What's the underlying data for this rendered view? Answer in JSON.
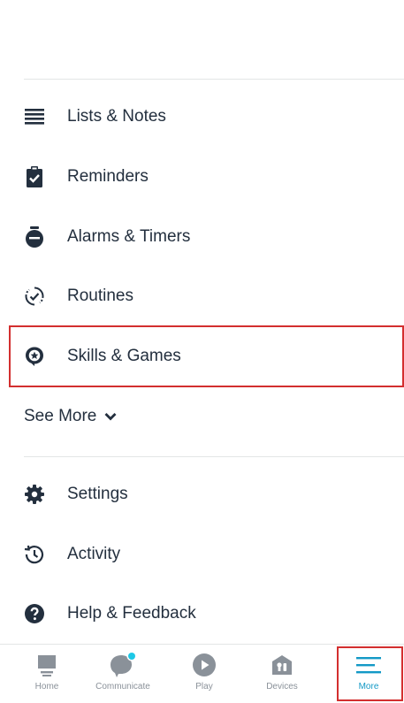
{
  "menu": {
    "items": [
      {
        "label": "Lists & Notes",
        "icon": "list-icon"
      },
      {
        "label": "Reminders",
        "icon": "clipboard-check-icon"
      },
      {
        "label": "Alarms & Timers",
        "icon": "stopwatch-icon"
      },
      {
        "label": "Routines",
        "icon": "routines-cycle-icon"
      },
      {
        "label": "Skills & Games",
        "icon": "skills-star-bubble-icon"
      }
    ],
    "see_more_label": "See More",
    "secondary": [
      {
        "label": "Settings",
        "icon": "gear-icon"
      },
      {
        "label": "Activity",
        "icon": "history-clock-icon"
      },
      {
        "label": "Help & Feedback",
        "icon": "help-question-icon"
      }
    ]
  },
  "tabbar": {
    "tabs": [
      {
        "label": "Home",
        "icon": "home-icon"
      },
      {
        "label": "Communicate",
        "icon": "chat-bubble-icon"
      },
      {
        "label": "Play",
        "icon": "play-icon"
      },
      {
        "label": "Devices",
        "icon": "devices-house-icon"
      },
      {
        "label": "More",
        "icon": "hamburger-menu-icon",
        "active": true
      }
    ]
  },
  "colors": {
    "text": "#232f3e",
    "accent": "#1399c6",
    "highlight": "#d32f2f",
    "tab_inactive": "#8a9199",
    "notification_dot": "#1ec8e6"
  }
}
